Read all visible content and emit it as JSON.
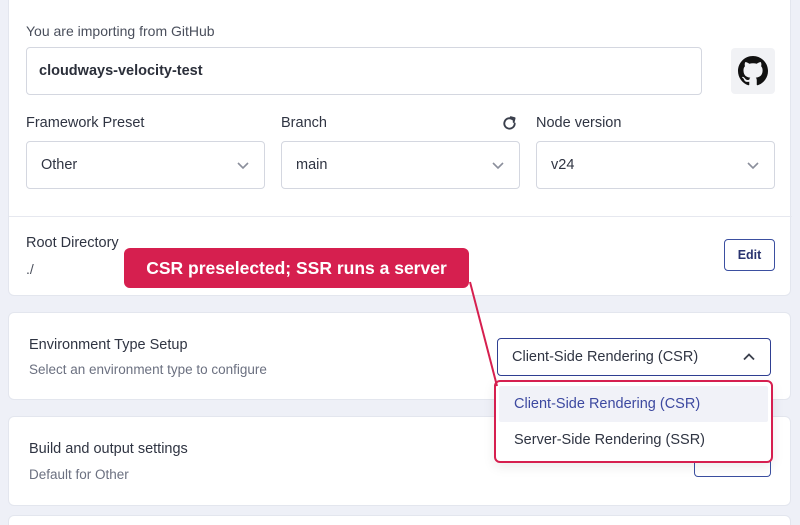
{
  "import": {
    "label": "You are importing from GitHub",
    "repo_name": "cloudways-velocity-test",
    "provider_icon": "github-icon"
  },
  "fields": {
    "framework": {
      "label": "Framework Preset",
      "value": "Other"
    },
    "branch": {
      "label": "Branch",
      "value": "main",
      "refresh_icon": "refresh-icon"
    },
    "node": {
      "label": "Node version",
      "value": "v24"
    }
  },
  "root": {
    "title": "Root Directory",
    "value": "./",
    "edit_label": "Edit"
  },
  "environment": {
    "title": "Environment Type Setup",
    "subtitle": "Select an environment type to configure",
    "selected": "Client-Side Rendering (CSR)",
    "options": [
      "Client-Side Rendering (CSR)",
      "Server-Side Rendering (SSR)"
    ]
  },
  "build": {
    "title": "Build and output settings",
    "subtitle": "Default for Other"
  },
  "annotation": {
    "text": "CSR preselected; SSR runs a server",
    "color": "#d61f4f"
  }
}
